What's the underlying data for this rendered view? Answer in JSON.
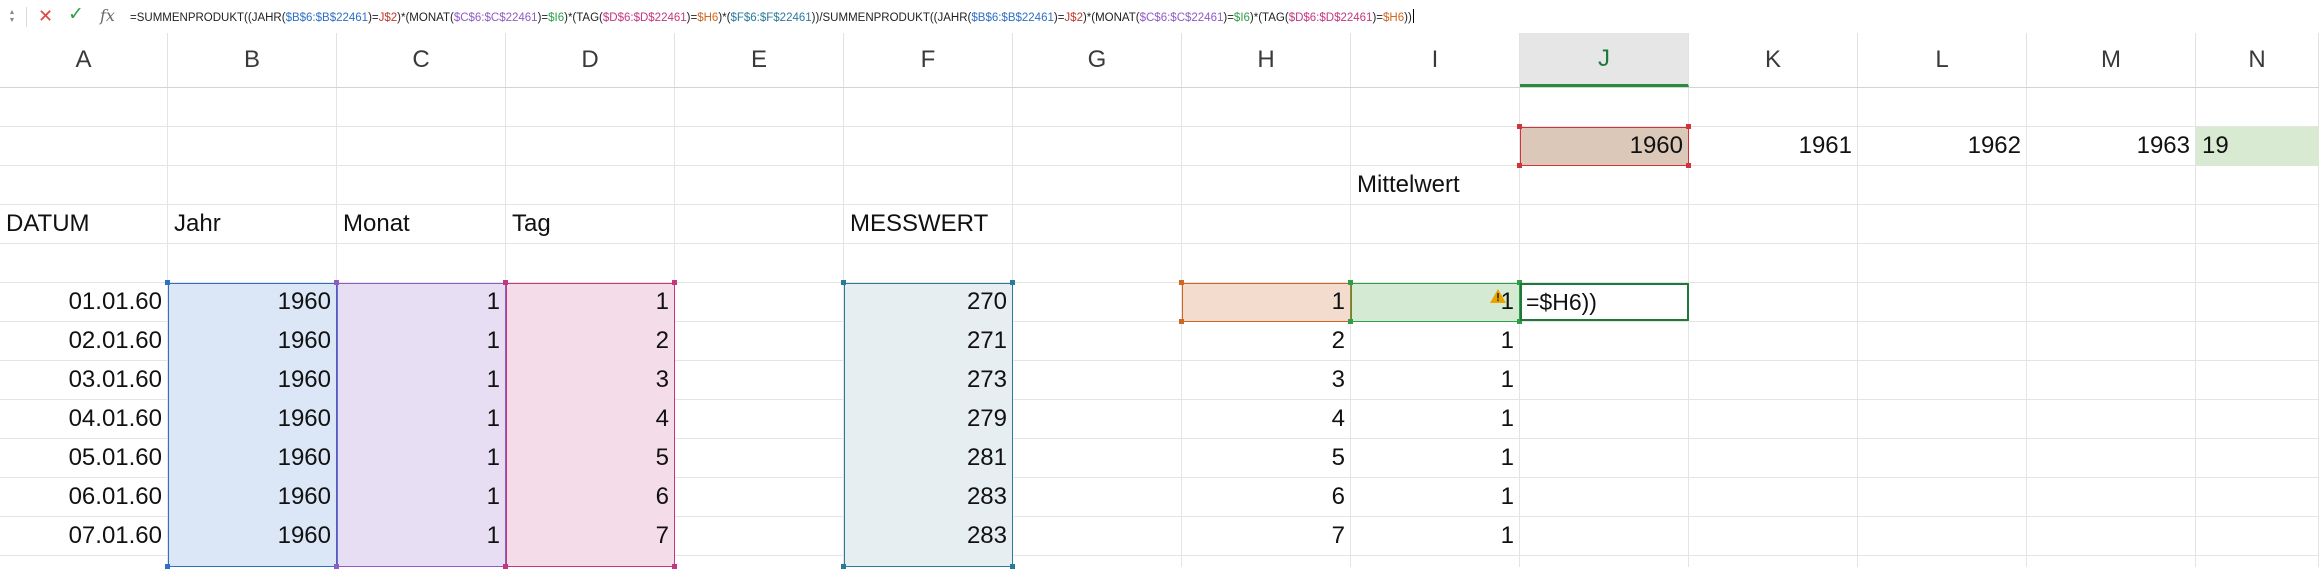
{
  "formula_bar": {
    "formula_parts": [
      {
        "t": "=SUMMENPRODUKT((JAHR(",
        "c": "#222222"
      },
      {
        "t": "$B$6:$B$22461",
        "c": "#2f6fc4"
      },
      {
        "t": ")=",
        "c": "#222222"
      },
      {
        "t": "J$2",
        "c": "#c0392b"
      },
      {
        "t": ")*(MONAT(",
        "c": "#222222"
      },
      {
        "t": "$C$6:$C$22461",
        "c": "#8e5cc4"
      },
      {
        "t": ")=",
        "c": "#222222"
      },
      {
        "t": "$I6",
        "c": "#2e9e48"
      },
      {
        "t": ")*(TAG(",
        "c": "#222222"
      },
      {
        "t": "$D$6:$D$22461",
        "c": "#c4377e"
      },
      {
        "t": ")=",
        "c": "#222222"
      },
      {
        "t": "$H6",
        "c": "#d0661f"
      },
      {
        "t": ")*(",
        "c": "#222222"
      },
      {
        "t": "$F$6:$F$22461",
        "c": "#2a7b9b"
      },
      {
        "t": "))/SUMMENPRODUKT((JAHR(",
        "c": "#222222"
      },
      {
        "t": "$B$6:$B$22461",
        "c": "#2f6fc4"
      },
      {
        "t": ")=",
        "c": "#222222"
      },
      {
        "t": "J$2",
        "c": "#c0392b"
      },
      {
        "t": ")*(MONAT(",
        "c": "#222222"
      },
      {
        "t": "$C$6:$C$22461",
        "c": "#8e5cc4"
      },
      {
        "t": ")=",
        "c": "#222222"
      },
      {
        "t": "$I6",
        "c": "#2e9e48"
      },
      {
        "t": ")*(TAG(",
        "c": "#222222"
      },
      {
        "t": "$D$6:$D$22461",
        "c": "#c4377e"
      },
      {
        "t": ")=",
        "c": "#222222"
      },
      {
        "t": "$H6",
        "c": "#d0661f"
      },
      {
        "t": "))",
        "c": "#222222"
      }
    ]
  },
  "columns": [
    "A",
    "B",
    "C",
    "D",
    "E",
    "F",
    "G",
    "H",
    "I",
    "J",
    "K",
    "L",
    "M",
    "N"
  ],
  "active_column": "J",
  "year_headers": [
    "1960",
    "1961",
    "1962",
    "1963",
    "19"
  ],
  "labels": {
    "mittelwert": "Mittelwert",
    "datum": "DATUM",
    "jahr": "Jahr",
    "monat": "Monat",
    "tag": "Tag",
    "messwert": "MESSWERT"
  },
  "rows": [
    {
      "datum": "01.01.60",
      "jahr": "1960",
      "monat": "1",
      "tag": "1",
      "messwert": "270",
      "h": "1",
      "i": "1"
    },
    {
      "datum": "02.01.60",
      "jahr": "1960",
      "monat": "1",
      "tag": "2",
      "messwert": "271",
      "h": "2",
      "i": "1"
    },
    {
      "datum": "03.01.60",
      "jahr": "1960",
      "monat": "1",
      "tag": "3",
      "messwert": "273",
      "h": "3",
      "i": "1"
    },
    {
      "datum": "04.01.60",
      "jahr": "1960",
      "monat": "1",
      "tag": "4",
      "messwert": "279",
      "h": "4",
      "i": "1"
    },
    {
      "datum": "05.01.60",
      "jahr": "1960",
      "monat": "1",
      "tag": "5",
      "messwert": "281",
      "h": "5",
      "i": "1"
    },
    {
      "datum": "06.01.60",
      "jahr": "1960",
      "monat": "1",
      "tag": "6",
      "messwert": "283",
      "h": "6",
      "i": "1"
    },
    {
      "datum": "07.01.60",
      "jahr": "1960",
      "monat": "1",
      "tag": "7",
      "messwert": "283",
      "h": "7",
      "i": "1"
    }
  ],
  "editing_cell_text": "=$H6))",
  "colors": {
    "jahr_fill": "#dbe6f6",
    "jahr_border": "#2f6fc4",
    "monat_fill": "#e7def3",
    "monat_border": "#8e5cc4",
    "tag_fill": "#f4dde8",
    "tag_border": "#c4377e",
    "messwert_fill": "#e6eef2",
    "messwert_border": "#2a7b9b",
    "h_fill": "#f3dccd",
    "h_border": "#d0661f",
    "i_fill": "#d5ead2",
    "i_border": "#2e9e48",
    "j2_fill": "#dcc8b8",
    "j2_border": "#d0343a",
    "n2_fill": "#d9ead3",
    "active_cell_border": "#1f7a3a",
    "warning": "#e9a400"
  }
}
